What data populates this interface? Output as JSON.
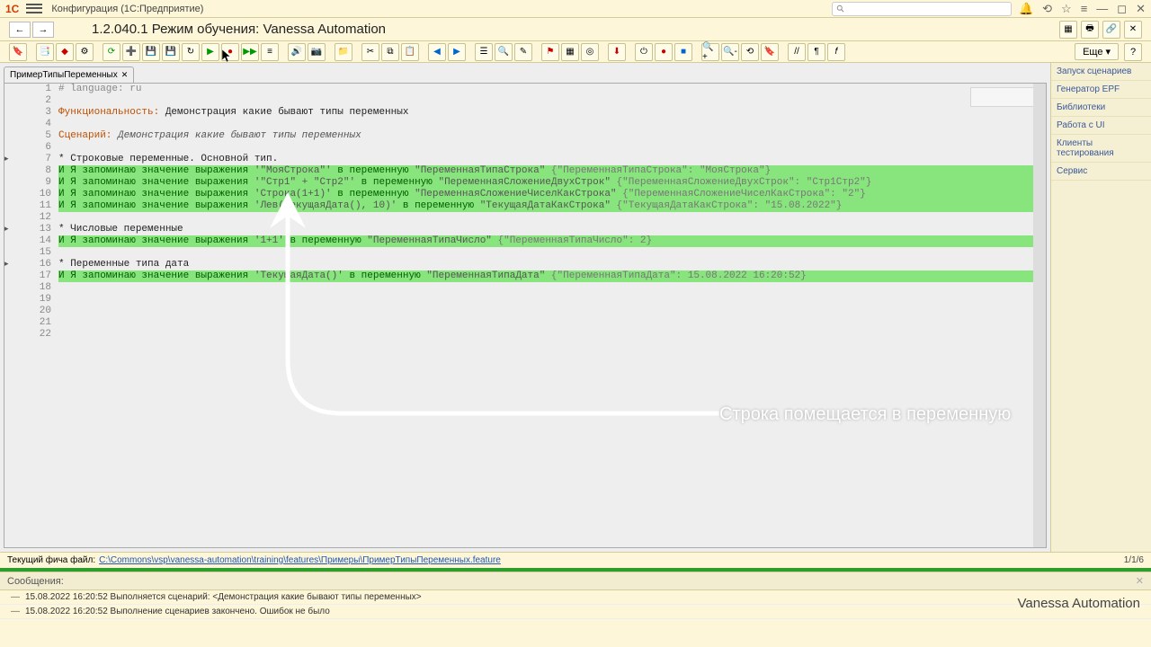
{
  "title_bar": {
    "logo": "1C",
    "title": "Конфигурация  (1С:Предприятие)",
    "search_placeholder": ""
  },
  "nav": {
    "page_title": "1.2.040.1 Режим обучения: Vanessa Automation"
  },
  "toolbar": {
    "more": "Еще"
  },
  "sidebar": {
    "items": [
      "Запуск сценариев",
      "Генератор EPF",
      "Библиотеки",
      "Работа с UI",
      "Клиенты тестирования",
      "Сервис"
    ]
  },
  "tab": {
    "name": "ПримерТипыПеременных"
  },
  "code": {
    "line_count": 22,
    "lines": [
      {
        "n": 1,
        "segs": [
          [
            "# language: ru",
            "c-gray"
          ]
        ]
      },
      {
        "n": 2,
        "segs": []
      },
      {
        "n": 3,
        "segs": [
          [
            "Функциональность:",
            "c-orange"
          ],
          [
            " Демонстрация какие бывают типы переменных",
            "c-black"
          ]
        ]
      },
      {
        "n": 4,
        "segs": []
      },
      {
        "n": 5,
        "segs": [
          [
            "Сценарий:",
            "c-orange"
          ],
          [
            " Демонстрация какие бывают типы переменных",
            "c-italic"
          ]
        ]
      },
      {
        "n": 6,
        "segs": []
      },
      {
        "n": 7,
        "segs": [
          [
            "    * Строковые переменные. Основной тип.",
            "c-black"
          ]
        ]
      },
      {
        "n": 8,
        "hl": true,
        "segs": [
          [
            "        И Я запоминаю значение выражения ",
            "c-green"
          ],
          [
            "'\"МояСтрока\"'",
            "c-str"
          ],
          [
            "  в переменную ",
            "c-green"
          ],
          [
            "\"ПеременнаяТипаСтрока\"",
            "c-var"
          ],
          [
            "     {\"ПеременнаяТипаСтрока\": \"МояСтрока\"}",
            "c-comment"
          ]
        ]
      },
      {
        "n": 9,
        "hl": true,
        "segs": [
          [
            "        И Я запоминаю значение выражения ",
            "c-green"
          ],
          [
            "'\"Стр1\" + \"Стр2\"'",
            "c-str"
          ],
          [
            "  в переменную ",
            "c-green"
          ],
          [
            "\"ПеременнаяСложениеДвухСтрок\"",
            "c-var"
          ],
          [
            "    {\"ПеременнаяСложениеДвухСтрок\": \"Стр1Стр2\"}",
            "c-comment"
          ]
        ]
      },
      {
        "n": 10,
        "hl": true,
        "segs": [
          [
            "        И Я запоминаю значение выражения ",
            "c-green"
          ],
          [
            "'Строка(1+1)'",
            "c-str"
          ],
          [
            "  в переменную ",
            "c-green"
          ],
          [
            "\"ПеременнаяСложениеЧиселКакСтрока\"",
            "c-var"
          ],
          [
            "    {\"ПеременнаяСложениеЧиселКакСтрока\": \"2\"}",
            "c-comment"
          ]
        ]
      },
      {
        "n": 11,
        "hl": true,
        "segs": [
          [
            "        И Я запоминаю значение выражения ",
            "c-green"
          ],
          [
            "'Лев(ТекущаяДата(), 10)'",
            "c-str"
          ],
          [
            "  в переменную ",
            "c-green"
          ],
          [
            "\"ТекущаяДатаКакСтрока\"",
            "c-var"
          ],
          [
            "    {\"ТекущаяДатаКакСтрока\": \"15.08.2022\"}",
            "c-comment"
          ]
        ]
      },
      {
        "n": 12,
        "segs": []
      },
      {
        "n": 13,
        "segs": [
          [
            "    * Числовые переменные",
            "c-black"
          ]
        ]
      },
      {
        "n": 14,
        "hl": true,
        "segs": [
          [
            "        И Я запоминаю значение выражения ",
            "c-green"
          ],
          [
            "'1+1'",
            "c-str"
          ],
          [
            "  в переменную ",
            "c-green"
          ],
          [
            "\"ПеременнаяТипаЧисло\"",
            "c-var"
          ],
          [
            "     {\"ПеременнаяТипаЧисло\": 2}",
            "c-comment"
          ]
        ]
      },
      {
        "n": 15,
        "segs": []
      },
      {
        "n": 16,
        "segs": [
          [
            "    * Переменные типа дата",
            "c-black"
          ]
        ]
      },
      {
        "n": 17,
        "hl": true,
        "segs": [
          [
            "        И Я запоминаю значение выражения ",
            "c-green"
          ],
          [
            "'ТекущаяДата()'",
            "c-str"
          ],
          [
            "  в переменную ",
            "c-green"
          ],
          [
            "\"ПеременнаяТипаДата\"",
            "c-var"
          ],
          [
            "    {\"ПеременнаяТипаДата\": 15.08.2022 16:20:52}",
            "c-comment"
          ]
        ]
      },
      {
        "n": 18,
        "segs": []
      },
      {
        "n": 19,
        "segs": []
      },
      {
        "n": 20,
        "segs": []
      },
      {
        "n": 21,
        "segs": []
      },
      {
        "n": 22,
        "segs": []
      }
    ]
  },
  "status": {
    "label": "Текущий фича файл:",
    "path": "C:\\Commons\\vsp\\vanessa-automation\\training\\features\\Примеры\\ПримерТипыПеременных.feature",
    "pager": "1/1/6"
  },
  "messages": {
    "header": "Сообщения:",
    "rows": [
      "15.08.2022 16:20:52 Выполняется сценарий: <Демонстрация какие бывают типы переменных>",
      "15.08.2022 16:20:52 Выполнение сценариев закончено. Ошибок не было"
    ]
  },
  "footer": {
    "brand": "Vanessa Automation"
  },
  "annotation": {
    "text": "Строка помещается в переменную"
  }
}
